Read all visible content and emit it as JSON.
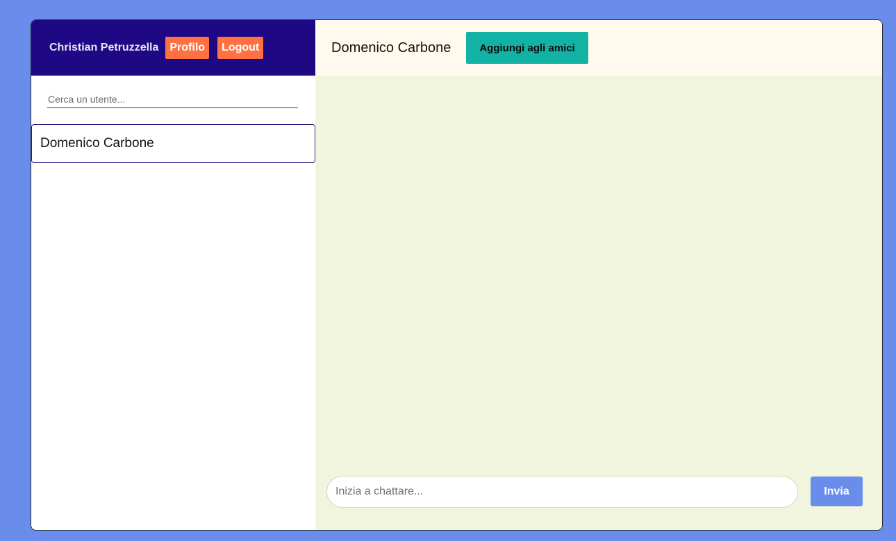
{
  "sidebar": {
    "header": {
      "user_name": "Christian Petruzzella",
      "profile_label": "Profilo",
      "logout_label": "Logout"
    },
    "search": {
      "placeholder": "Cerca un utente...",
      "value": ""
    },
    "contacts": [
      {
        "name": "Domenico Carbone"
      }
    ]
  },
  "chat": {
    "header": {
      "title": "Domenico Carbone",
      "add_friend_label": "Aggiungi agli amici"
    },
    "composer": {
      "placeholder": "Inizia a chattare...",
      "value": "",
      "send_label": "Invia"
    }
  },
  "colors": {
    "page_background": "#6a8dec",
    "sidebar_header": "#1f0883",
    "header_button": "#ff7043",
    "add_friend_button": "#12b3a4",
    "chat_background": "#f2f5de",
    "chat_header_background": "#fffaed",
    "send_button": "#6a8dec"
  }
}
